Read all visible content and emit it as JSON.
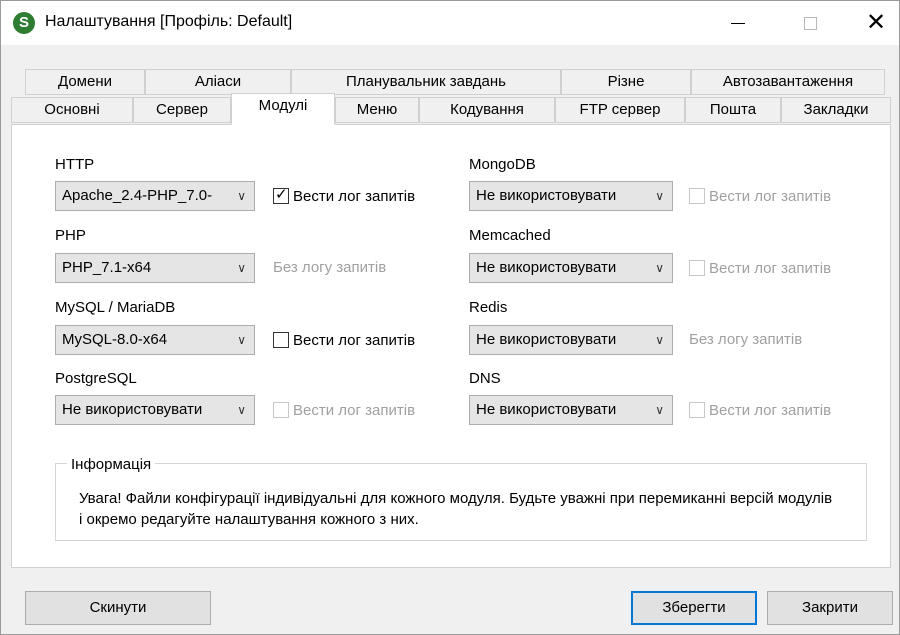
{
  "window": {
    "title": "Налаштування [Профіль: Default]",
    "icon_letter": "S",
    "controls": {
      "minimize": "—",
      "close": "✕"
    }
  },
  "tabs_row1": [
    "Домени",
    "Аліаси",
    "Планувальник завдань",
    "Різне",
    "Автозавантаження"
  ],
  "tabs_row2": [
    "Основні",
    "Сервер",
    "Модулі",
    "Меню",
    "Кодування",
    "FTP сервер",
    "Пошта",
    "Закладки"
  ],
  "active_tab": "Модулі",
  "modules_left": [
    {
      "label": "HTTP",
      "selected": "Apache_2.4-PHP_7.0-",
      "log_type": "checkbox",
      "log_label": "Вести лог запитів",
      "checked": true,
      "enabled": true
    },
    {
      "label": "PHP",
      "selected": "PHP_7.1-x64",
      "log_type": "text",
      "log_label": "Без логу запитів"
    },
    {
      "label": "MySQL / MariaDB",
      "selected": "MySQL-8.0-x64",
      "log_type": "checkbox",
      "log_label": "Вести лог запитів",
      "checked": false,
      "enabled": true
    },
    {
      "label": "PostgreSQL",
      "selected": "Не використовувати",
      "log_type": "checkbox",
      "log_label": "Вести лог запитів",
      "checked": false,
      "enabled": false
    }
  ],
  "modules_right": [
    {
      "label": "MongoDB",
      "selected": "Не використовувати",
      "log_type": "checkbox",
      "log_label": "Вести лог запитів",
      "checked": false,
      "enabled": false
    },
    {
      "label": "Memcached",
      "selected": "Не використовувати",
      "log_type": "checkbox",
      "log_label": "Вести лог запитів",
      "checked": false,
      "enabled": false
    },
    {
      "label": "Redis",
      "selected": "Не використовувати",
      "log_type": "text",
      "log_label": "Без логу запитів"
    },
    {
      "label": "DNS",
      "selected": "Не використовувати",
      "log_type": "checkbox",
      "log_label": "Вести лог запитів",
      "checked": false,
      "enabled": false
    }
  ],
  "info": {
    "title": "Інформація",
    "text": "Увага! Файли конфігурації індивідуальні для кожного модуля. Будьте уважні при перемиканні версій модулів і окремо редагуйте налаштування кожного з них."
  },
  "buttons": {
    "reset": "Скинути",
    "save": "Зберегти",
    "close": "Закрити"
  }
}
